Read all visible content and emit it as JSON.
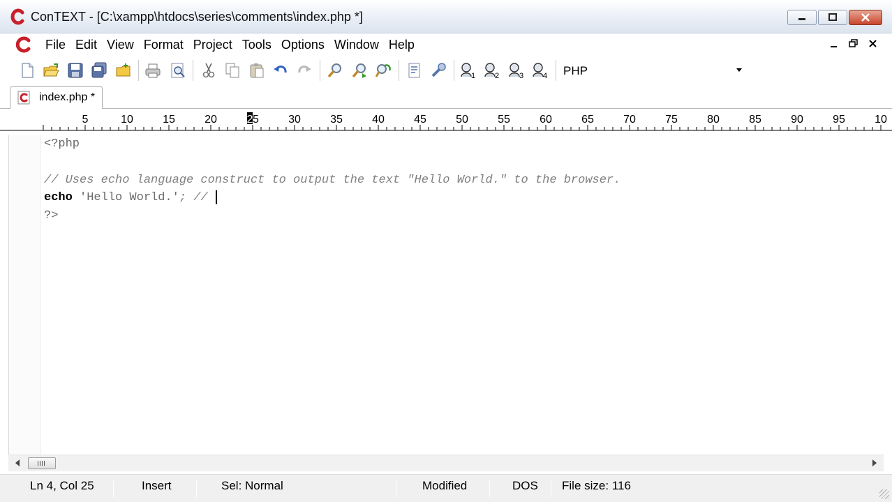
{
  "window": {
    "title": "ConTEXT - [C:\\xampp\\htdocs\\series\\comments\\index.php *]",
    "brand_color": "#c8202a"
  },
  "menu": {
    "items": [
      "File",
      "Edit",
      "View",
      "Format",
      "Project",
      "Tools",
      "Options",
      "Window",
      "Help"
    ]
  },
  "toolbar": {
    "language": "PHP",
    "buttons": [
      "new-file-icon",
      "open-file-icon",
      "save-icon",
      "save-all-icon",
      "open-folder-icon",
      "print-icon",
      "print-preview-icon",
      "cut-icon",
      "copy-icon",
      "paste-icon",
      "undo-icon",
      "redo-icon",
      "find-icon",
      "find-next-icon",
      "replace-icon",
      "export-icon",
      "tools-icon",
      "user-command-1-icon",
      "user-command-2-icon",
      "user-command-3-icon",
      "user-command-4-icon"
    ]
  },
  "tab": {
    "label": "index.php *"
  },
  "ruler": {
    "labels": [
      "5",
      "10",
      "15",
      "20",
      "25",
      "30",
      "35",
      "40",
      "45",
      "50",
      "55",
      "60",
      "65",
      "70",
      "75",
      "80",
      "85",
      "90",
      "95",
      "10"
    ],
    "current_column": "25"
  },
  "editor": {
    "lines": [
      {
        "text": "<?php",
        "kind": "tag"
      },
      {
        "text": "",
        "kind": "blank"
      },
      {
        "text": "// Uses echo language construct to output the text \"Hello World.\" to the browser.",
        "kind": "comment"
      },
      {
        "keyword": "echo",
        "string": "'Hello World.'",
        "rest": "; //",
        "kind": "statement"
      },
      {
        "text": "?>",
        "kind": "tag"
      }
    ]
  },
  "status": {
    "position": "Ln 4, Col 25",
    "mode": "Insert",
    "selection": "Sel: Normal",
    "modified": "Modified",
    "line_ending": "DOS",
    "file_size": "File size: 116"
  }
}
